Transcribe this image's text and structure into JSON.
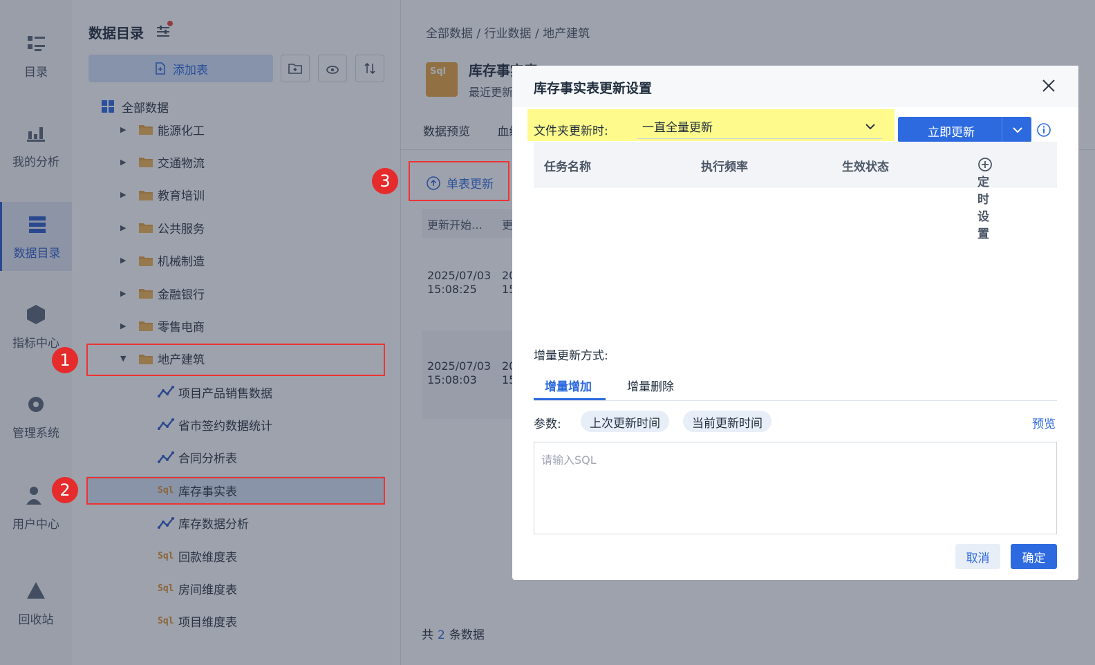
{
  "nav": [
    {
      "label": "目录",
      "icon": "list-icon"
    },
    {
      "label": "我的分析",
      "icon": "chart-icon"
    },
    {
      "label": "数据目录",
      "icon": "catalog-icon"
    },
    {
      "label": "指标中心",
      "icon": "cube-icon"
    },
    {
      "label": "管理系统",
      "icon": "gear-icon"
    },
    {
      "label": "用户中心",
      "icon": "user-icon"
    },
    {
      "label": "回收站",
      "icon": "recycle-icon"
    }
  ],
  "tree": {
    "title": "数据目录",
    "add_label": "添加表",
    "root": "全部数据",
    "folders": [
      "能源化工",
      "交通物流",
      "教育培训",
      "公共服务",
      "机械制造",
      "金融银行",
      "零售电商",
      "地产建筑"
    ],
    "children": [
      {
        "label": "项目产品销售数据",
        "type": "analysis"
      },
      {
        "label": "省市签约数据统计",
        "type": "analysis"
      },
      {
        "label": "合同分析表",
        "type": "analysis"
      },
      {
        "label": "库存事实表",
        "type": "sql"
      },
      {
        "label": "库存数据分析",
        "type": "analysis"
      },
      {
        "label": "回款维度表",
        "type": "sql"
      },
      {
        "label": "房间维度表",
        "type": "sql"
      },
      {
        "label": "项目维度表",
        "type": "sql"
      }
    ],
    "sql_glyph": "Sql"
  },
  "badges": [
    "1",
    "2",
    "3"
  ],
  "main": {
    "breadcrumb": "全部数据 / 行业数据 / 地产建筑",
    "file_title": "库存事实表",
    "file_sub": "最近更新",
    "tabs": [
      "数据预览",
      "血缘"
    ],
    "single_update": "单表更新",
    "col_head": "更新开始…",
    "col_head2": "更",
    "rows": [
      {
        "date": "2025/07/03",
        "time": "15:08:25",
        "d2": "20",
        "t2": "15"
      },
      {
        "date": "2025/07/03",
        "time": "15:08:03",
        "d2": "20",
        "t2": "15"
      }
    ],
    "total_pre": "共",
    "total_n": "2",
    "total_post": "条数据"
  },
  "dialog": {
    "title": "库存事实表更新设置",
    "update_label": "文件夹更新时:",
    "update_mode": "一直全量更新",
    "update_now": "立即更新",
    "cols": [
      "任务名称",
      "执行频率",
      "生效状态",
      "定时设置"
    ],
    "inc_label": "增量更新方式:",
    "subtabs": [
      "增量增加",
      "增量删除"
    ],
    "param_label": "参数:",
    "chips": [
      "上次更新时间",
      "当前更新时间"
    ],
    "preview": "预览",
    "sql_placeholder": "请输入SQL",
    "cancel": "取消",
    "ok": "确定"
  },
  "colors": {
    "accent": "#2d6ae0",
    "highlight": "#fefb8c",
    "red": "#e52b2b"
  }
}
